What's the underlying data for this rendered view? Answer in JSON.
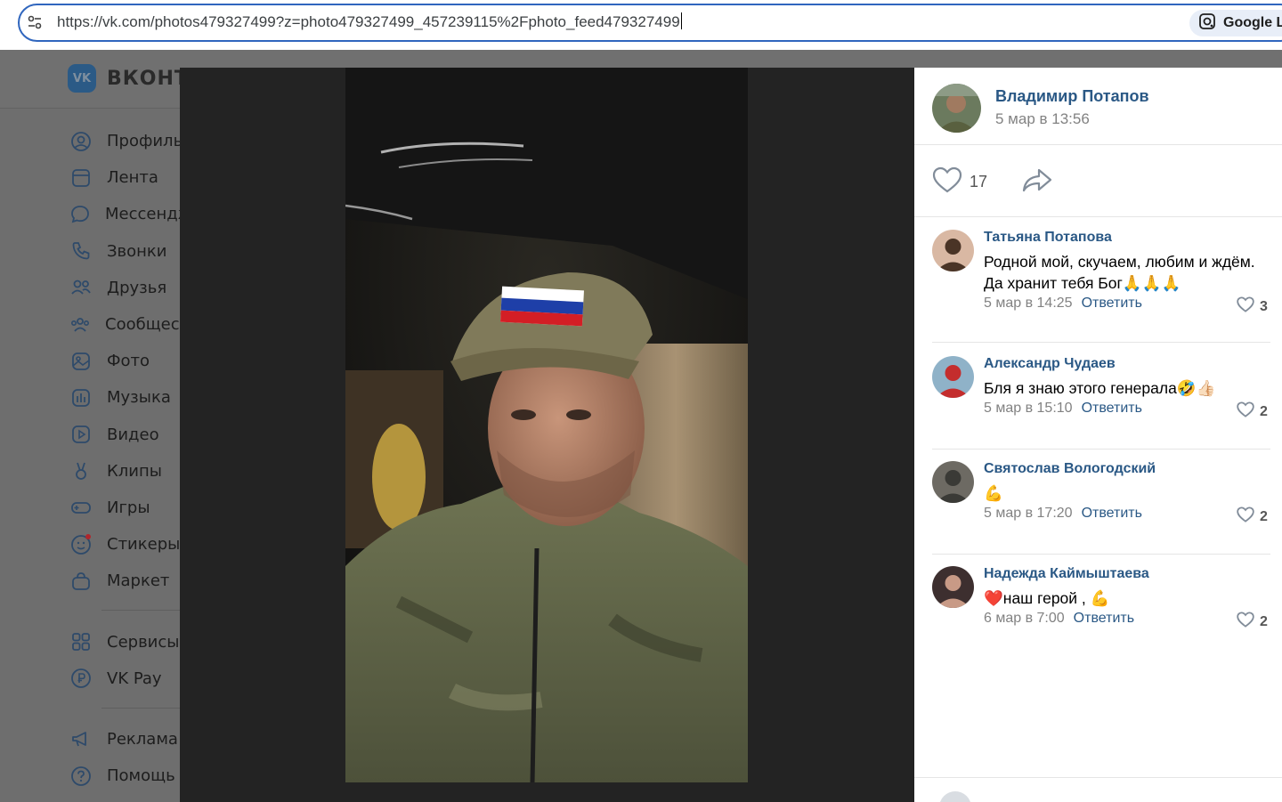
{
  "browser": {
    "url": "https://vk.com/photos479327499?z=photo479327499_457239115%2Fphoto_feed479327499",
    "lens_label": "Google Le"
  },
  "vk": {
    "brand": "ВКОНТ",
    "sidebar": {
      "items": [
        {
          "label": "Профиль",
          "icon": "user-icon"
        },
        {
          "label": "Лента",
          "icon": "feed-icon"
        },
        {
          "label": "Мессендж",
          "icon": "message-icon"
        },
        {
          "label": "Звонки",
          "icon": "phone-icon"
        },
        {
          "label": "Друзья",
          "icon": "friends-icon"
        },
        {
          "label": "Сообщест",
          "icon": "communities-icon"
        },
        {
          "label": "Фото",
          "icon": "photo-icon"
        },
        {
          "label": "Музыка",
          "icon": "music-icon"
        },
        {
          "label": "Видео",
          "icon": "video-icon"
        },
        {
          "label": "Клипы",
          "icon": "clips-icon"
        },
        {
          "label": "Игры",
          "icon": "games-icon"
        },
        {
          "label": "Стикеры",
          "icon": "stickers-icon"
        },
        {
          "label": "Маркет",
          "icon": "market-icon"
        }
      ],
      "items2": [
        {
          "label": "Сервисы",
          "icon": "services-icon"
        },
        {
          "label": "VK Pay",
          "icon": "vkpay-icon"
        }
      ],
      "items3": [
        {
          "label": "Реклама",
          "icon": "ads-icon"
        },
        {
          "label": "Помощь",
          "icon": "help-icon"
        }
      ]
    }
  },
  "post": {
    "author_name": "Владимир Потапов",
    "date": "5 мар в 13:56",
    "likes": "17"
  },
  "comments": [
    {
      "name": "Татьяна Потапова",
      "text": "Родной мой, скучаем, любим и ждём. Да хранит тебя Бог🙏🙏🙏",
      "date": "5 мар в 14:25",
      "reply": "Ответить",
      "likes": "3"
    },
    {
      "name": "Александр Чудаев",
      "text": "Бля я знаю этого генерала🤣👍🏻",
      "date": "5 мар в 15:10",
      "reply": "Ответить",
      "likes": "2"
    },
    {
      "name": "Святослав Вологодский",
      "text": "💪",
      "date": "5 мар в 17:20",
      "reply": "Ответить",
      "likes": "2"
    },
    {
      "name": "Надежда Каймыштаева",
      "text": "❤️наш герой , 💪",
      "date": "6 мар в 7:00",
      "reply": "Ответить",
      "likes": "2"
    }
  ],
  "colors": {
    "link": "#2a5885",
    "meta": "#828282",
    "overlay": "#232323"
  }
}
